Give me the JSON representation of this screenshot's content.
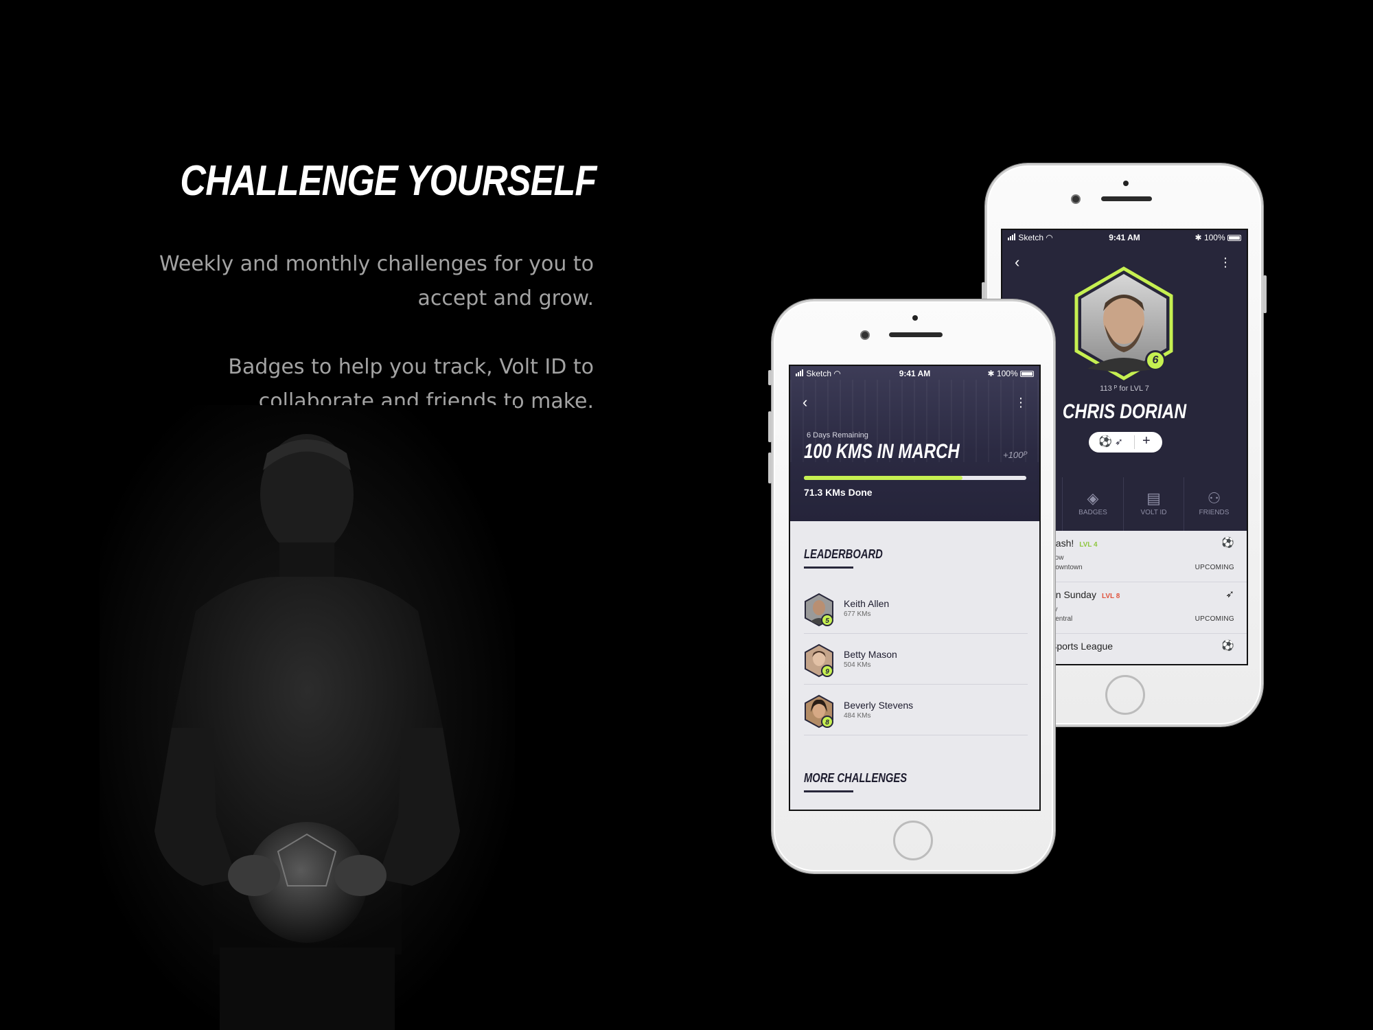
{
  "marketing": {
    "headline": "CHALLENGE YOURSELF",
    "paragraph1": "Weekly and monthly challenges for you to accept and grow.",
    "paragraph2": "Badges to help you track, Volt ID to collaborate and friends to make."
  },
  "status_bar": {
    "carrier": "Sketch",
    "time": "9:41 AM",
    "battery": "100%"
  },
  "profile_screen": {
    "level_badge": "6",
    "points_to_level": "113 ᴾ for LVL 7",
    "name": "CHRIS DORIAN",
    "tabs": [
      {
        "label": "BADGES",
        "icon": "diamond-icon"
      },
      {
        "label": "VOLT ID",
        "icon": "id-card-icon"
      },
      {
        "label": "FRIENDS",
        "icon": "friends-icon"
      }
    ],
    "events": [
      {
        "title": "nash!",
        "level": "LVL 4",
        "level_color": "#8ec63f",
        "line1": "rrow",
        "line2": "Downtown",
        "status": "UPCOMING",
        "icon": "soccer-ball-icon"
      },
      {
        "title": "on Sunday",
        "level": "LVL 8",
        "level_color": "#e0533d",
        "line1": "ay",
        "line2": "Central",
        "status": "UPCOMING",
        "icon": "shuttlecock-icon"
      },
      {
        "title": "Sports League",
        "level": "",
        "level_color": "",
        "line1": "",
        "line2": "",
        "status": "",
        "icon": "soccer-ball-icon"
      }
    ]
  },
  "challenge_screen": {
    "remaining": "6 Days Remaining",
    "title": "100 KMS IN MARCH",
    "points": "+100ᴾ",
    "progress_fraction": 0.713,
    "progress_text": "71.3 KMs Done",
    "leaderboard_title": "LEADERBOARD",
    "leaderboard": [
      {
        "name": "Keith Allen",
        "distance": "677 KMs",
        "level": "5"
      },
      {
        "name": "Betty Mason",
        "distance": "504 KMs",
        "level": "9"
      },
      {
        "name": "Beverly Stevens",
        "distance": "484 KMs",
        "level": "8"
      }
    ],
    "more_title": "MORE CHALLENGES"
  },
  "colors": {
    "accent": "#c6f051",
    "navy": "#27263a",
    "screen_bg": "#e9e9ed"
  }
}
